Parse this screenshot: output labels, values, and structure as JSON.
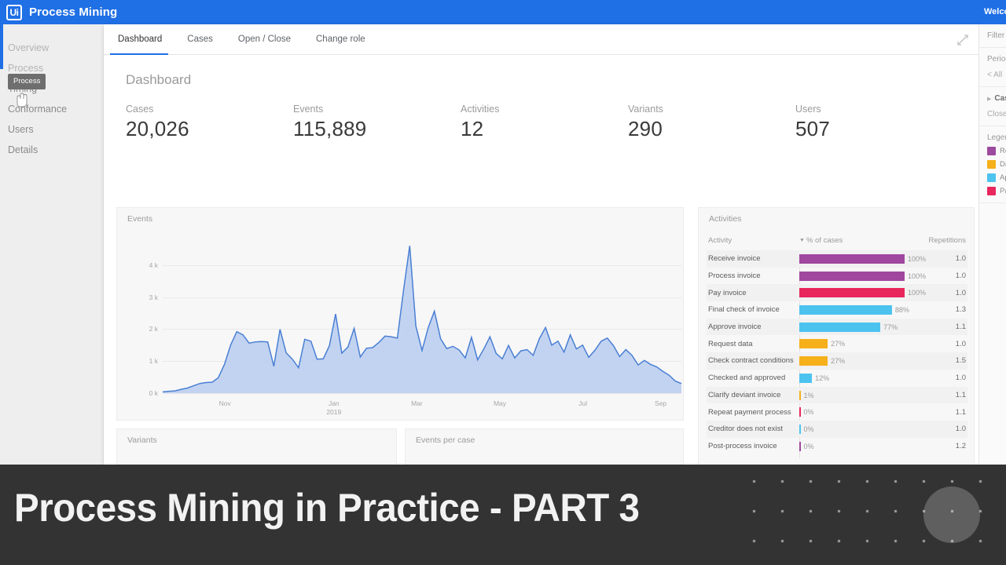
{
  "topbar": {
    "logo_text": "Ui",
    "logo_icon": "uipath-logo-icon",
    "brand": "Process Mining",
    "welcome": "Welcome"
  },
  "tabs": [
    {
      "label": "Dashboard",
      "active": true
    },
    {
      "label": "Cases",
      "active": false
    },
    {
      "label": "Open / Close",
      "active": false
    },
    {
      "label": "Change role",
      "active": false
    }
  ],
  "expand_icon": "expand-diagonal-icon",
  "sidebar": {
    "tooltip": "Process",
    "items": [
      {
        "label": "Overview",
        "state": "hidden-behind-tooltip"
      },
      {
        "label": "Process",
        "state": "hovered"
      },
      {
        "label": "Timing",
        "state": "normal"
      },
      {
        "label": "Conformance",
        "state": "normal"
      },
      {
        "label": "Users",
        "state": "normal"
      },
      {
        "label": "Details",
        "state": "normal"
      }
    ]
  },
  "page": {
    "title": "Dashboard",
    "kpis": [
      {
        "label": "Cases",
        "value": "20,026"
      },
      {
        "label": "Events",
        "value": "115,889"
      },
      {
        "label": "Activities",
        "value": "12"
      },
      {
        "label": "Variants",
        "value": "290"
      },
      {
        "label": "Users",
        "value": "507"
      }
    ],
    "panels": {
      "events": "Events",
      "variants": "Variants",
      "events_per_case": "Events per case",
      "activities": "Activities"
    }
  },
  "activities_table": {
    "columns": [
      "Activity",
      "% of cases",
      "Repetitions"
    ],
    "sort_column": "% of cases",
    "sort_direction": "desc",
    "rows": [
      {
        "activity": "Receive invoice",
        "pct": "100%",
        "pct_value": 100,
        "repetitions": "1.0",
        "color": "#a0479f"
      },
      {
        "activity": "Process invoice",
        "pct": "100%",
        "pct_value": 100,
        "repetitions": "1.0",
        "color": "#a0479f"
      },
      {
        "activity": "Pay invoice",
        "pct": "100%",
        "pct_value": 100,
        "repetitions": "1.0",
        "color": "#e8265c"
      },
      {
        "activity": "Final check of invoice",
        "pct": "88%",
        "pct_value": 88,
        "repetitions": "1.3",
        "color": "#4cc3ef"
      },
      {
        "activity": "Approve invoice",
        "pct": "77%",
        "pct_value": 77,
        "repetitions": "1.1",
        "color": "#4cc3ef"
      },
      {
        "activity": "Request data",
        "pct": "27%",
        "pct_value": 27,
        "repetitions": "1.0",
        "color": "#f5b01a"
      },
      {
        "activity": "Check contract conditions",
        "pct": "27%",
        "pct_value": 27,
        "repetitions": "1.5",
        "color": "#f5b01a"
      },
      {
        "activity": "Checked and approved",
        "pct": "12%",
        "pct_value": 12,
        "repetitions": "1.0",
        "color": "#4cc3ef"
      },
      {
        "activity": "Clarify deviant invoice",
        "pct": "1%",
        "pct_value": 1,
        "repetitions": "1.1",
        "color": "#f5b01a"
      },
      {
        "activity": "Repeat payment process",
        "pct": "0%",
        "pct_value": 0.4,
        "repetitions": "1.1",
        "color": "#e8265c"
      },
      {
        "activity": "Creditor does not exist",
        "pct": "0%",
        "pct_value": 0.3,
        "repetitions": "1.0",
        "color": "#4cc3ef"
      },
      {
        "activity": "Post-process invoice",
        "pct": "0%",
        "pct_value": 0.3,
        "repetitions": "1.2",
        "color": "#a0479f"
      }
    ]
  },
  "right_rail": {
    "filter_title": "Filter",
    "period_title": "Period",
    "period_value": "< All",
    "cases_title": "Cases",
    "cases_value": "Closed",
    "legend_title": "Legend",
    "legend": [
      {
        "swatch": "#9c4a9e",
        "label": "Receive"
      },
      {
        "swatch": "#f5b01a",
        "label": "Data"
      },
      {
        "swatch": "#4cc3ef",
        "label": "Approve"
      },
      {
        "swatch": "#e8265c",
        "label": "Pay"
      }
    ]
  },
  "banner": {
    "title": "Process Mining in Practice - PART 3",
    "background": "#333333",
    "circle_color": "rgba(255,255,255,0.22)"
  },
  "chart_data": {
    "type": "area",
    "title": "Events",
    "xlabel": "",
    "ylabel": "",
    "ylim": [
      0,
      4800
    ],
    "ytick_labels": [
      "0 k",
      "1 k",
      "2 k",
      "3 k",
      "4 k"
    ],
    "ytick_values": [
      0,
      1000,
      2000,
      3000,
      4000
    ],
    "grid": true,
    "xtick_labels": [
      "Nov",
      "Jan\n2019",
      "Mar",
      "May",
      "Jul",
      "Sep"
    ],
    "xtick_positions": [
      0.12,
      0.33,
      0.49,
      0.65,
      0.81,
      0.96
    ],
    "line_color": "#4a7fd4",
    "fill_color": "#b9cdf0",
    "series": [
      {
        "name": "Events",
        "values": [
          40,
          60,
          70,
          120,
          160,
          230,
          300,
          330,
          340,
          480,
          900,
          1500,
          1920,
          1820,
          1560,
          1600,
          1610,
          1600,
          840,
          1990,
          1260,
          1060,
          790,
          1680,
          1620,
          1060,
          1070,
          1480,
          2470,
          1250,
          1440,
          2020,
          1130,
          1400,
          1420,
          1580,
          1780,
          1760,
          1720,
          3200,
          4600,
          2100,
          1330,
          2050,
          2560,
          1700,
          1390,
          1460,
          1350,
          1100,
          1740,
          1040,
          1380,
          1760,
          1240,
          1070,
          1490,
          1100,
          1320,
          1360,
          1180,
          1700,
          2050,
          1500,
          1620,
          1280,
          1820,
          1380,
          1500,
          1120,
          1340,
          1620,
          1720,
          1480,
          1140,
          1360,
          1180,
          880,
          1020,
          900,
          820,
          680,
          560,
          380,
          300
        ]
      }
    ]
  }
}
